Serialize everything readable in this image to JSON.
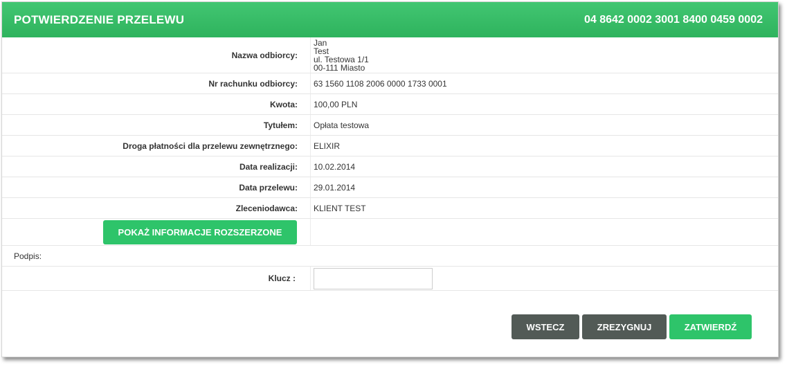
{
  "header": {
    "title": "POTWIERDZENIE PRZELEWU",
    "account": "04 8642 0002 3001 8400 0459 0002"
  },
  "recipient": {
    "label": "Nazwa odbiorcy:",
    "lines": [
      "Jan",
      "Test",
      "ul. Testowa 1/1",
      "00-111 Miasto"
    ]
  },
  "fields": [
    {
      "label": "Nr rachunku odbiorcy:",
      "value": "63 1560 1108 2006 0000 1733 0001"
    },
    {
      "label": "Kwota:",
      "value": "100,00 PLN"
    },
    {
      "label": "Tytułem:",
      "value": "Opłata testowa"
    },
    {
      "label": "Droga płatności dla przelewu zewnętrznego:",
      "value": "ELIXIR"
    },
    {
      "label": "Data realizacji:",
      "value": "10.02.2014"
    },
    {
      "label": "Data przelewu:",
      "value": "29.01.2014"
    },
    {
      "label": "Zleceniodawca:",
      "value": "KLIENT TEST"
    }
  ],
  "extended_button": "POKAŻ INFORMACJE ROZSZERZONE",
  "signature": {
    "label": "Podpis:",
    "key_label": "Klucz :",
    "key_value": ""
  },
  "actions": {
    "back": "WSTECZ",
    "cancel": "ZREZYGNUJ",
    "confirm": "ZATWIERDŹ"
  },
  "colors": {
    "accent_green": "#2ec46a",
    "dark_button": "#525a56"
  }
}
